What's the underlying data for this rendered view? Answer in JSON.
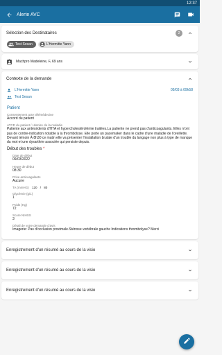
{
  "status_bar": {
    "time": "12:37"
  },
  "app_bar": {
    "title": "Alerte AVC",
    "icons": [
      "back-arrow-icon",
      "chat-icon",
      "video-icon"
    ]
  },
  "recipients": {
    "label": "Sélection des Destinataires",
    "count": "2",
    "chips": [
      "Test Sesan",
      "L'Hermitte Yann"
    ]
  },
  "patient": {
    "label": "Machpro Madeleine, F, 69 ans"
  },
  "context": {
    "label": "Contexte de la demande",
    "sender": "L'Hermitte Yann",
    "sent_at": "09/03 à 09h58",
    "recipient": "Test Sesan"
  },
  "patient_section": {
    "title": "Patient",
    "consent_label": "Consentement acte télémédecine",
    "consent_value": "Accord du patient",
    "history_label": "ATCD du patient / Histoire de la maladie",
    "history_value": "Patiente aux antécédents d'HTA et hypercholestérolémie traitées.La patiente ne prend pas d'anticoagulants. Elles n'ont pas de contre-indication notable à la thrombolyse. Elle porte un pacemaker dans le cadre d'une maladie de l'oreillette. Devant témoin À 8h30 ce matin elle va présenter l'installation brutale d'un trouble du langage non plus à type de manque du mot et une dysarthrie associée qui persiste depuis."
  },
  "symptoms": {
    "title": "Début des troubles",
    "required_mark": "*",
    "start_date_label": "Date de début",
    "start_date_value": "09/03/2022",
    "start_time_label": "Heure de début",
    "start_time_value": "08:30",
    "anticoag_label": "Prise anticoagulants",
    "anticoag_value": "Aucune",
    "ta_label": "TA (mmHG)",
    "ta_sys": "120",
    "ta_sep": "/",
    "ta_dia": "80",
    "glycemia_label": "Glycémie (g/L)",
    "glycemia_value": "1",
    "weight_label": "Poids (Kg)",
    "weight_value": "72",
    "nihss_label": "Score NIHSS",
    "nihss_value": "3",
    "detail_label": "Détail de votre demande d'avis",
    "detail_value": "Imagerie: Pas d'occlusion proximale.Sténose vertébrale gauche Indications thrombolyse? Merci"
  },
  "recordings": [
    "Enregistrement d'un résumé au cours de la visio",
    "Enregistrement d'un résumé au cours de la visio",
    "Enregistrement d'un résumé au cours de la visio"
  ],
  "colors": {
    "primary": "#1a6fa1",
    "status_bar": "#114e73",
    "required": "#d32f2f"
  }
}
